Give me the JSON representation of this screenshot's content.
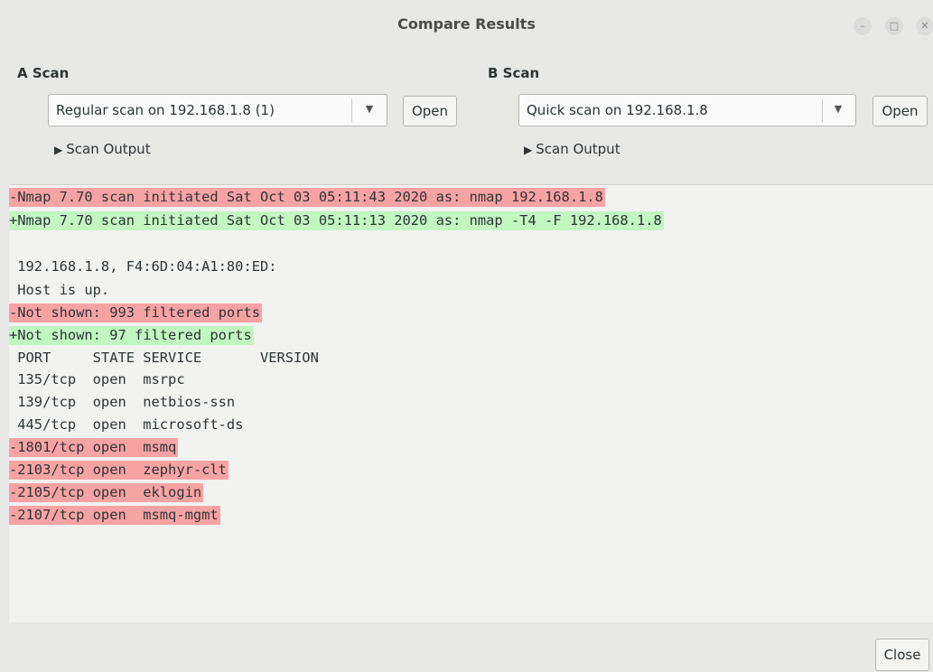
{
  "window": {
    "title": "Compare Results",
    "controls": [
      "–",
      "□",
      "✕"
    ]
  },
  "a_scan": {
    "label": "A Scan",
    "selected": "Regular scan on 192.168.1.8 (1)",
    "open_label": "Open",
    "output_label": "Scan Output"
  },
  "b_scan": {
    "label": "B Scan",
    "selected": "Quick scan on 192.168.1.8",
    "open_label": "Open",
    "output_label": "Scan Output"
  },
  "diff": {
    "lines": [
      {
        "type": "del",
        "text": "-Nmap 7.70 scan initiated Sat Oct 03 05:11:43 2020 as: nmap 192.168.1.8"
      },
      {
        "type": "add",
        "text": "+Nmap 7.70 scan initiated Sat Oct 03 05:11:13 2020 as: nmap -T4 -F 192.168.1.8"
      },
      {
        "type": "ctx",
        "text": ""
      },
      {
        "type": "ctx",
        "text": " 192.168.1.8, F4:6D:04:A1:80:ED:"
      },
      {
        "type": "ctx",
        "text": " Host is up."
      },
      {
        "type": "del",
        "text": "-Not shown: 993 filtered ports"
      },
      {
        "type": "add",
        "text": "+Not shown: 97 filtered ports"
      },
      {
        "type": "ctx",
        "text": " PORT     STATE SERVICE       VERSION"
      },
      {
        "type": "ctx",
        "text": " 135/tcp  open  msrpc"
      },
      {
        "type": "ctx",
        "text": " 139/tcp  open  netbios-ssn"
      },
      {
        "type": "ctx",
        "text": " 445/tcp  open  microsoft-ds"
      },
      {
        "type": "del",
        "text": "-1801/tcp open  msmq"
      },
      {
        "type": "del",
        "text": "-2103/tcp open  zephyr-clt"
      },
      {
        "type": "del",
        "text": "-2105/tcp open  eklogin"
      },
      {
        "type": "del",
        "text": "-2107/tcp open  msmq-mgmt"
      }
    ]
  },
  "footer": {
    "close_label": "Close"
  },
  "colors": {
    "deleted": "#f8a3a3",
    "added": "#c2f7c2"
  }
}
